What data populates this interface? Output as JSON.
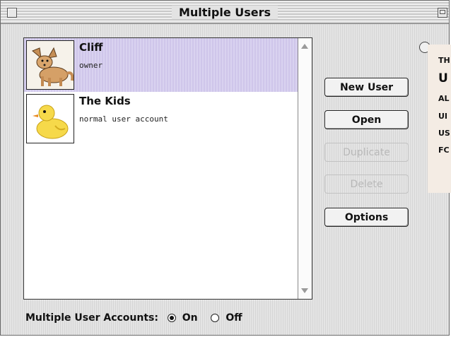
{
  "window": {
    "title": "Multiple Users"
  },
  "users": [
    {
      "name": "Cliff",
      "type": "owner",
      "avatar": "fox-icon"
    },
    {
      "name": "The Kids",
      "type": "normal user account",
      "avatar": "rubber-duck-icon"
    }
  ],
  "buttons": {
    "new_user": "New User",
    "open": "Open",
    "duplicate": "Duplicate",
    "delete": "Delete",
    "options": "Options"
  },
  "overlay_text": [
    "TH",
    "U",
    "AL",
    "UI",
    "US",
    "FC"
  ],
  "bottom": {
    "label": "Multiple User Accounts:",
    "on_label": "On",
    "off_label": "Off",
    "selected": "On"
  },
  "colors": {
    "selection": "#d9d2f0",
    "overlay_bg": "#f4ece4"
  }
}
